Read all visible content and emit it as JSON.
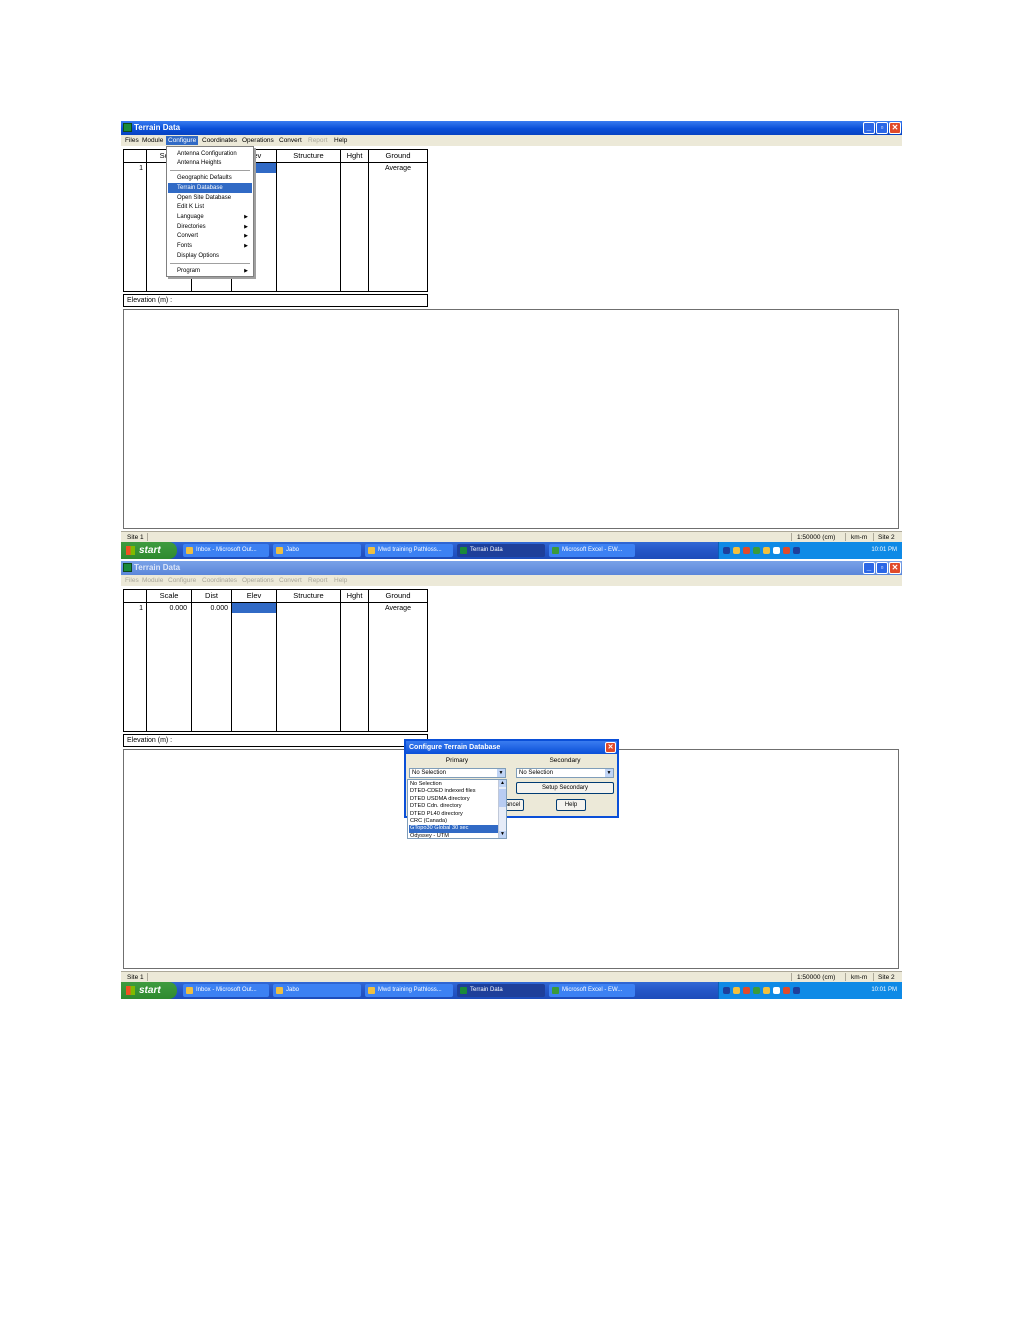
{
  "window": {
    "title": "Terrain Data",
    "buttons": {
      "minimize": "_",
      "maximize": "▫",
      "close": "✕"
    }
  },
  "menubar": [
    "Files",
    "Module",
    "Configure",
    "Coordinates",
    "Operations",
    "Convert",
    "Report",
    "Help"
  ],
  "table": {
    "headers": [
      "Scale",
      "Dist",
      "Elev",
      "Structure",
      "Hght",
      "Ground"
    ],
    "row": {
      "index": "1",
      "scale": "0.000",
      "dist": "0.000",
      "elev": "",
      "structure": "",
      "hght": "",
      "ground": "Average"
    }
  },
  "elevation_label": "Elevation (m) :",
  "configure_menu": {
    "items": [
      {
        "label": "Antenna Configuration",
        "submenu": false
      },
      {
        "label": "Antenna Heights",
        "submenu": false
      },
      {
        "label": "Geographic Defaults",
        "submenu": false
      },
      {
        "label": "Terrain Database",
        "submenu": false,
        "highlighted": true
      },
      {
        "label": "Open Site Database",
        "submenu": false
      },
      {
        "label": "Edit K List",
        "submenu": false
      },
      {
        "label": "Language",
        "submenu": true
      },
      {
        "label": "Directories",
        "submenu": true
      },
      {
        "label": "Convert",
        "submenu": true
      },
      {
        "label": "Fonts",
        "submenu": true
      },
      {
        "label": "Display Options",
        "submenu": false
      },
      {
        "label": "Program",
        "submenu": true
      }
    ]
  },
  "status_bar": {
    "site1": "Site 1",
    "scale": "1:50000 (cm)",
    "units": "km-m",
    "site2": "Site 2"
  },
  "taskbar": {
    "start": "start",
    "buttons": [
      "Inbox - Microsoft Out...",
      "Jabo",
      "Mwd training Pathloss...",
      "Terrain Data",
      "Microsoft Excel - EW..."
    ],
    "clock": "10:01 PM"
  },
  "dialog": {
    "title": "Configure Terrain Database",
    "primary_label": "Primary",
    "secondary_label": "Secondary",
    "primary_value": "No Selection",
    "secondary_value": "No Selection",
    "setup_secondary": "Setup Secondary",
    "cancel": "ancel",
    "help": "Help",
    "options": [
      "No Selection",
      "DTED-CDED indexed files",
      "DTED USDMA directory",
      "DTED Cdn. directory",
      "DTED PL40 directory",
      "CRC (Canada)",
      "GTopo30 Global 30 sec",
      "Odyssey - UTM"
    ],
    "highlighted_option": "GTopo30 Global 30 sec"
  },
  "colors": {
    "titlebar": "#0a4fd8",
    "highlight": "#316ac5",
    "taskbar": "#2456c7",
    "start": "#3f9c3f"
  }
}
